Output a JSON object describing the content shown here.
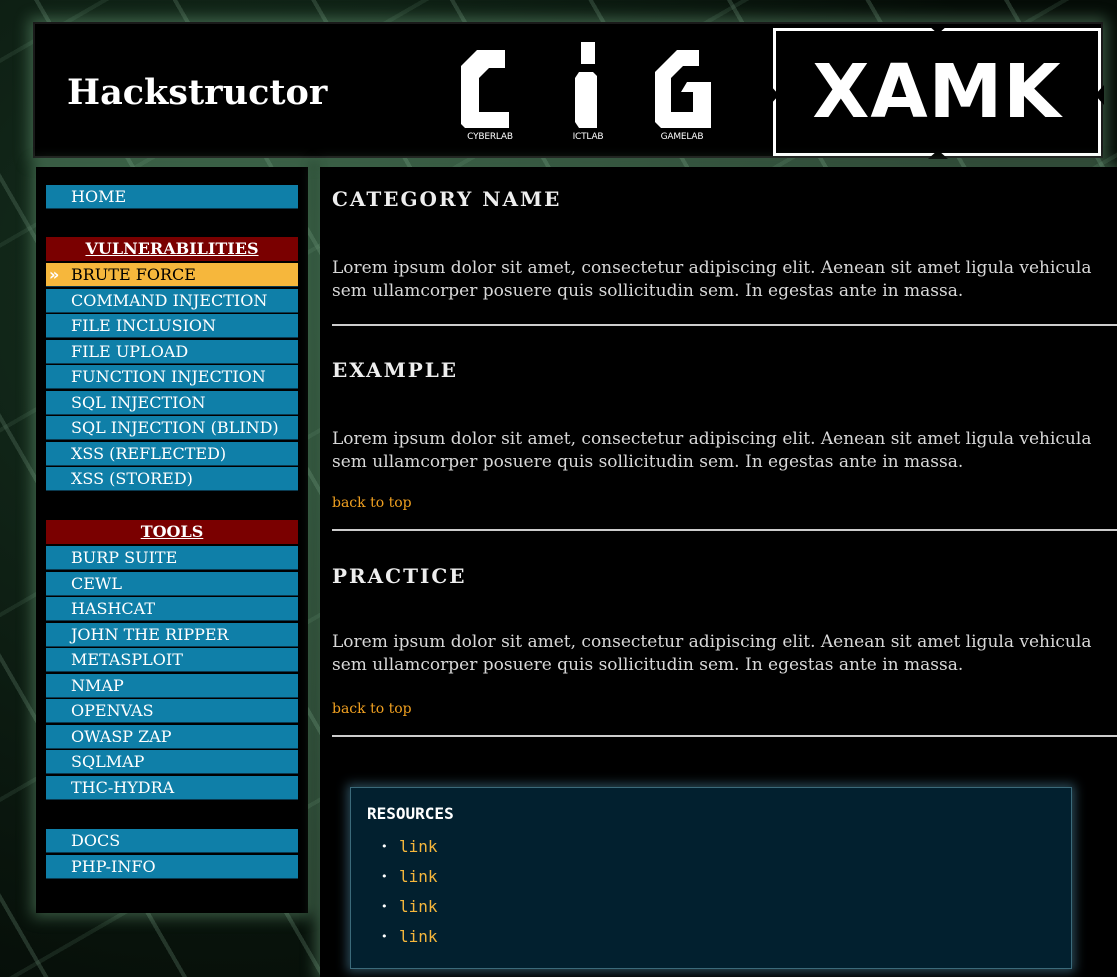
{
  "header": {
    "title": "Hackstructor",
    "labs": [
      "CYBERLAB",
      "ICTLAB",
      "GAMELAB"
    ],
    "partner_logo": "XAMK"
  },
  "sidebar": {
    "home": "HOME",
    "vulnerabilities_heading": "VULNERABILITIES",
    "vulnerabilities": [
      "BRUTE FORCE",
      "COMMAND INJECTION",
      "FILE INCLUSION",
      "FILE UPLOAD",
      "FUNCTION INJECTION",
      "SQL INJECTION",
      "SQL INJECTION (BLIND)",
      "XSS (REFLECTED)",
      "XSS (STORED)"
    ],
    "active_item": "BRUTE FORCE",
    "tools_heading": "TOOLS",
    "tools": [
      "BURP SUITE",
      "CEWL",
      "HASHCAT",
      "JOHN THE RIPPER",
      "METASPLOIT",
      "NMAP",
      "OPENVAS",
      "OWASP ZAP",
      "SQLMAP",
      "THC-HYDRA"
    ],
    "extras": [
      "DOCS",
      "PHP-INFO"
    ]
  },
  "main": {
    "sections": [
      {
        "title": "CATEGORY NAME",
        "text": "Lorem ipsum dolor sit amet, consectetur adipiscing elit. Aenean sit amet ligula vehicula sem ullamcorper posuere quis sollicitudin sem. In egestas ante in massa."
      },
      {
        "title": "EXAMPLE",
        "text": "Lorem ipsum dolor sit amet, consectetur adipiscing elit. Aenean sit amet ligula vehicula sem ullamcorper posuere quis sollicitudin sem. In egestas ante in massa.",
        "back_link": "back to top"
      },
      {
        "title": "PRACTICE",
        "text": "Lorem ipsum dolor sit amet, consectetur adipiscing elit. Aenean sit amet ligula vehicula sem ullamcorper posuere quis sollicitudin sem. In egestas ante in massa.",
        "back_link": "back to top"
      }
    ],
    "resources": {
      "title": "RESOURCES",
      "links": [
        "link",
        "link",
        "link",
        "link"
      ]
    }
  },
  "colors": {
    "nav_bg": "#0f7fa8",
    "nav_active": "#f6b73c",
    "nav_heading": "#7a0000",
    "link": "#f0a020"
  }
}
